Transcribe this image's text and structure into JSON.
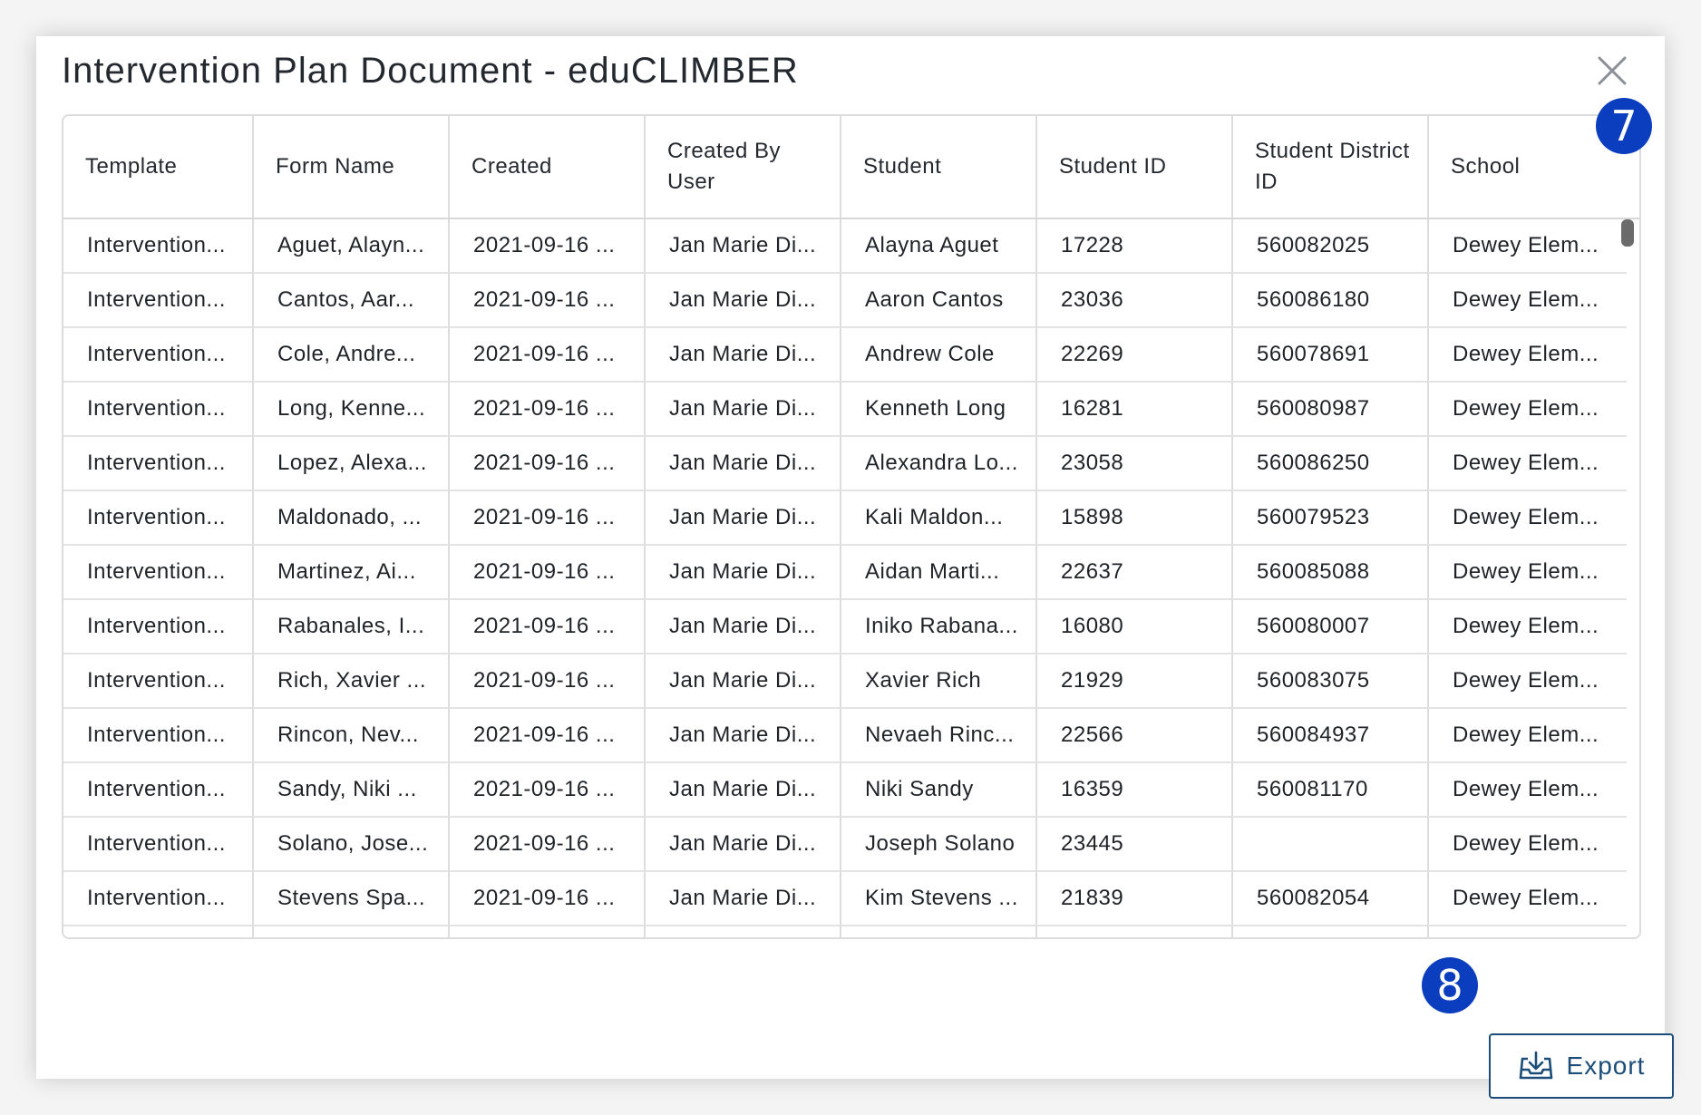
{
  "modal": {
    "title": "Intervention Plan Document - eduCLIMBER",
    "close_icon": "close-icon"
  },
  "table": {
    "columns": [
      "Template",
      "Form Name",
      "Created",
      "Created By User",
      "Student",
      "Student ID",
      "Student District ID",
      "School"
    ],
    "rows": [
      [
        "Intervention...",
        "Aguet, Alayn...",
        "2021-09-16 ...",
        "Jan Marie Di...",
        "Alayna Aguet",
        "17228",
        "560082025",
        "Dewey Elem..."
      ],
      [
        "Intervention...",
        "Cantos, Aar...",
        "2021-09-16 ...",
        "Jan Marie Di...",
        "Aaron Cantos",
        "23036",
        "560086180",
        "Dewey Elem..."
      ],
      [
        "Intervention...",
        "Cole, Andre...",
        "2021-09-16 ...",
        "Jan Marie Di...",
        "Andrew Cole",
        "22269",
        "560078691",
        "Dewey Elem..."
      ],
      [
        "Intervention...",
        "Long, Kenne...",
        "2021-09-16 ...",
        "Jan Marie Di...",
        "Kenneth Long",
        "16281",
        "560080987",
        "Dewey Elem..."
      ],
      [
        "Intervention...",
        "Lopez, Alexa...",
        "2021-09-16 ...",
        "Jan Marie Di...",
        "Alexandra Lo...",
        "23058",
        "560086250",
        "Dewey Elem..."
      ],
      [
        "Intervention...",
        "Maldonado, ...",
        "2021-09-16 ...",
        "Jan Marie Di...",
        "Kali Maldon...",
        "15898",
        "560079523",
        "Dewey Elem..."
      ],
      [
        "Intervention...",
        "Martinez, Ai...",
        "2021-09-16 ...",
        "Jan Marie Di...",
        "Aidan Marti...",
        "22637",
        "560085088",
        "Dewey Elem..."
      ],
      [
        "Intervention...",
        "Rabanales, I...",
        "2021-09-16 ...",
        "Jan Marie Di...",
        "Iniko Rabana...",
        "16080",
        "560080007",
        "Dewey Elem..."
      ],
      [
        "Intervention...",
        "Rich, Xavier ...",
        "2021-09-16 ...",
        "Jan Marie Di...",
        "Xavier Rich",
        "21929",
        "560083075",
        "Dewey Elem..."
      ],
      [
        "Intervention...",
        "Rincon, Nev...",
        "2021-09-16 ...",
        "Jan Marie Di...",
        "Nevaeh Rinc...",
        "22566",
        "560084937",
        "Dewey Elem..."
      ],
      [
        "Intervention...",
        "Sandy, Niki ...",
        "2021-09-16 ...",
        "Jan Marie Di...",
        "Niki Sandy",
        "16359",
        "560081170",
        "Dewey Elem..."
      ],
      [
        "Intervention...",
        "Solano, Jose...",
        "2021-09-16 ...",
        "Jan Marie Di...",
        "Joseph Solano",
        "23445",
        "",
        "Dewey Elem..."
      ],
      [
        "Intervention...",
        "Stevens Spa...",
        "2021-09-16 ...",
        "Jan Marie Di...",
        "Kim Stevens ...",
        "21839",
        "560082054",
        "Dewey Elem..."
      ],
      [
        "",
        "",
        "",
        "",
        "",
        "",
        "",
        ""
      ]
    ]
  },
  "callouts": {
    "badge_7": "7",
    "badge_8": "8"
  },
  "footer": {
    "export_label": "Export",
    "export_icon": "download-tray-icon"
  },
  "colors": {
    "badge": "#0b3ebf",
    "export_border": "#1b4d78"
  }
}
